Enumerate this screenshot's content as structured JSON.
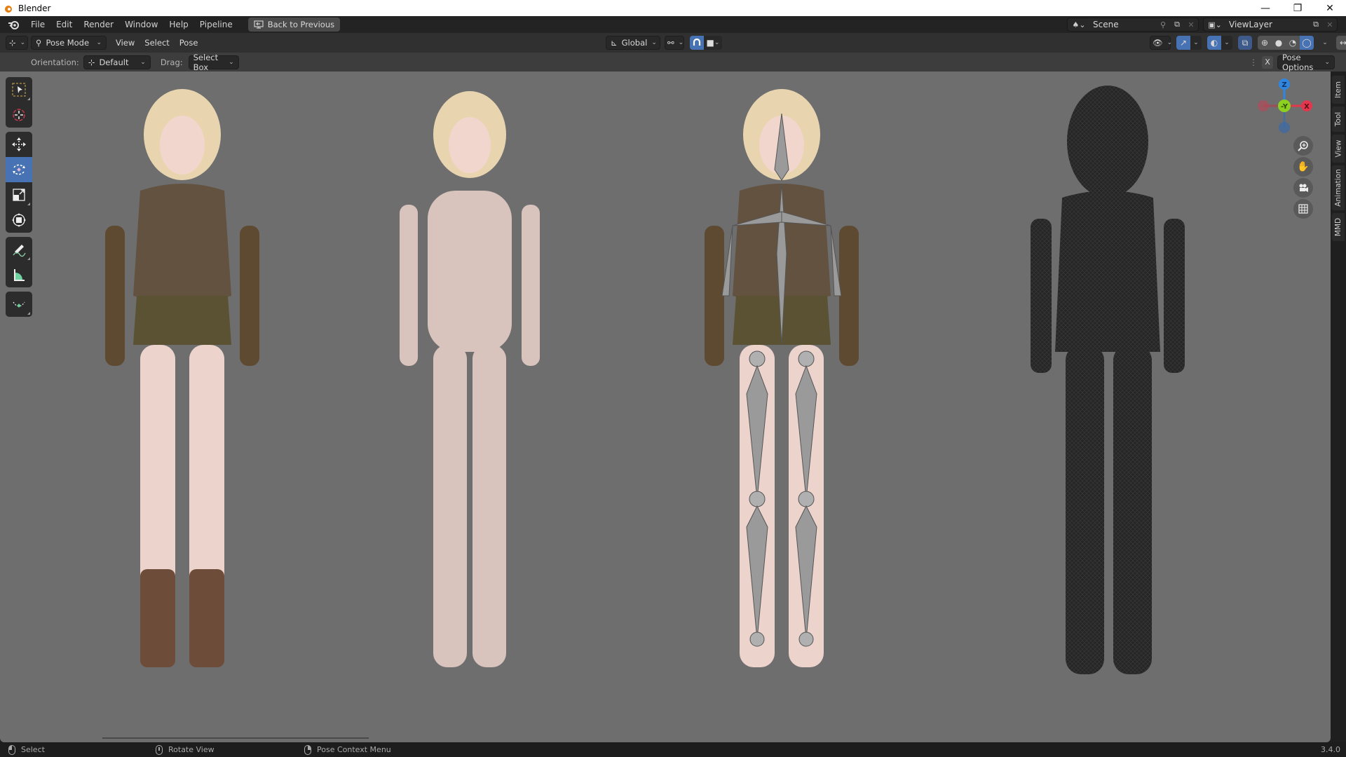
{
  "window": {
    "title": "Blender",
    "controls": {
      "minimize": "—",
      "restore": "❐",
      "close": "✕"
    }
  },
  "topbar": {
    "menus": [
      "File",
      "Edit",
      "Render",
      "Window",
      "Help",
      "Pipeline"
    ],
    "back_button": "Back to Previous",
    "scene": {
      "label": "Scene"
    },
    "view_layer": {
      "label": "ViewLayer"
    }
  },
  "viewport_header": {
    "mode": "Pose Mode",
    "menus": [
      "View",
      "Select",
      "Pose"
    ],
    "transform_orientation": "Global",
    "shading_active": "rendered"
  },
  "tool_header": {
    "orientation_label": "Orientation:",
    "orientation_value": "Default",
    "drag_label": "Drag:",
    "drag_value": "Select Box",
    "mirror_x": "X",
    "pose_options": "Pose Options"
  },
  "toolbar": {
    "tools": [
      "select-box",
      "cursor",
      "move",
      "rotate",
      "scale",
      "transform",
      "annotate",
      "measure",
      "relax-pose"
    ],
    "active": "rotate"
  },
  "gizmo": {
    "axes": {
      "z": "Z",
      "y": "-Y",
      "x": "X"
    },
    "colors": {
      "x": "#e2374d",
      "y": "#8cd11f",
      "z": "#2f86e0"
    }
  },
  "n_panel_tabs": [
    "Item",
    "Tool",
    "View",
    "Animation",
    "MMD"
  ],
  "figures": [
    {
      "name": "character-clothed"
    },
    {
      "name": "character-base-body"
    },
    {
      "name": "character-with-armature"
    },
    {
      "name": "character-wireframe"
    }
  ],
  "statusbar": {
    "left_click": "Select",
    "middle_click": "Rotate View",
    "right_click": "Pose Context Menu",
    "version": "3.4.0"
  },
  "colors": {
    "accent": "#4772b3",
    "viewport_bg": "#6e6e6e",
    "header_bg": "#303030"
  }
}
